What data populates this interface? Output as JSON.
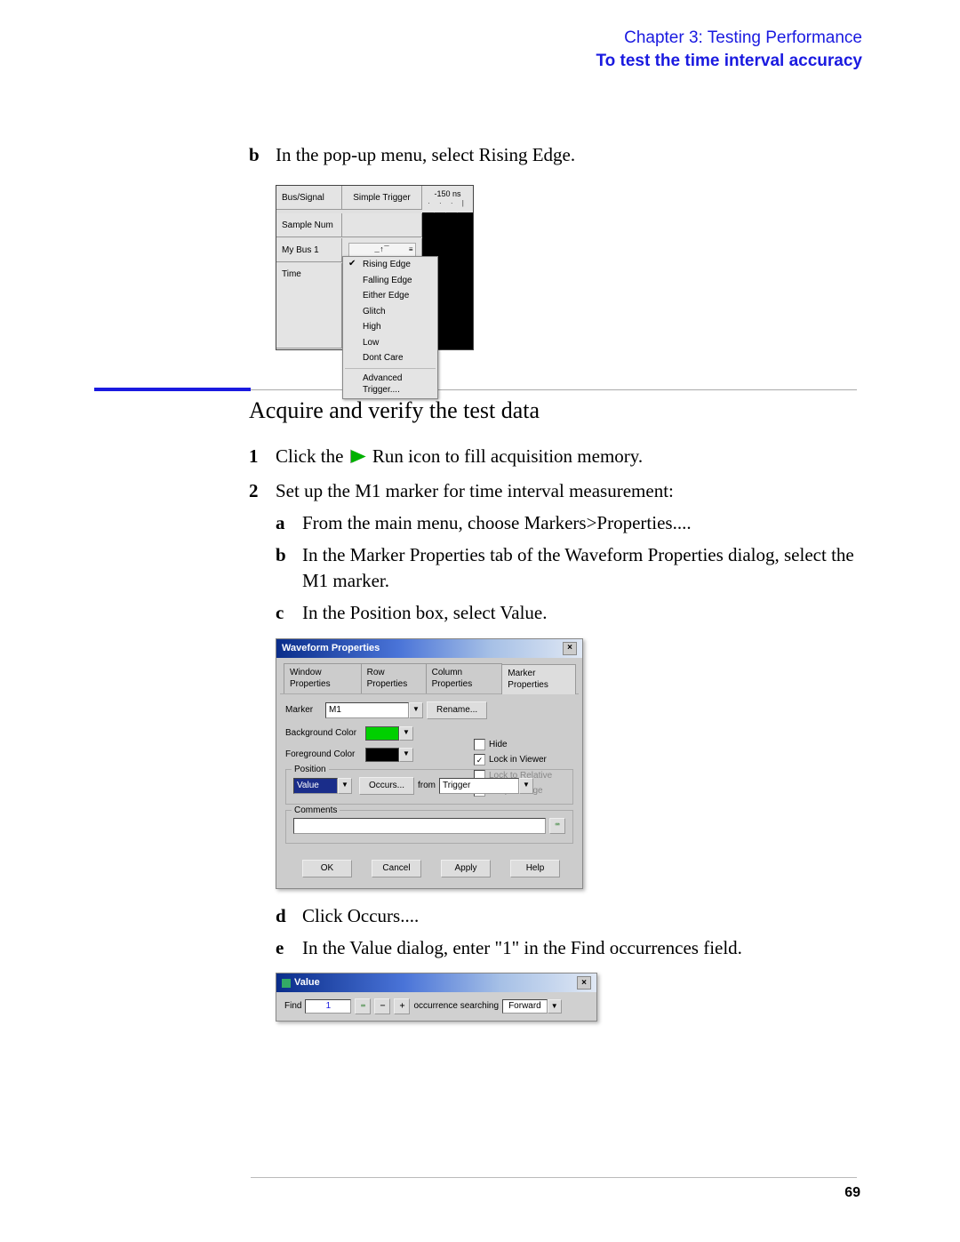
{
  "header": {
    "chapter": "Chapter 3: Testing Performance",
    "subtitle": "To test the time interval accuracy"
  },
  "step_b": "In the pop-up menu, select Rising Edge.",
  "shot1": {
    "col_bus": "Bus/Signal",
    "col_trigger": "Simple Trigger",
    "time_head": "-150 ns",
    "row_sample": "Sample Num",
    "row_mybus": "My Bus 1",
    "row_time": "Time",
    "menu": {
      "items": [
        "Rising Edge",
        "Falling Edge",
        "Either Edge",
        "Glitch",
        "High",
        "Low",
        "Dont Care"
      ],
      "advanced": "Advanced Trigger...."
    }
  },
  "section_heading": "Acquire and verify the test data",
  "step1_pre": "Click the",
  "step1_post": " Run icon to fill acquisition memory.",
  "step2": "Set up the M1 marker for time interval measurement:",
  "step2a": "From the main menu, choose Markers>Properties....",
  "step2b": "In the Marker Properties tab of the Waveform Properties dialog, select the M1 marker.",
  "step2c": "In the Position box, select Value.",
  "shot2": {
    "title": "Waveform Properties",
    "tabs": [
      "Window Properties",
      "Row Properties",
      "Column Properties",
      "Marker Properties"
    ],
    "marker_label": "Marker",
    "marker_value": "M1",
    "rename": "Rename...",
    "bg_label": "Background Color",
    "fg_label": "Foreground Color",
    "chk_hide": "Hide",
    "chk_lockviewer": "Lock in Viewer",
    "chk_lockrel": "Lock to Relative",
    "chk_snap": "Snap to Edge",
    "group_position": "Position",
    "pos_value": "Value",
    "occurs": "Occurs...",
    "from": "from",
    "trigger": "Trigger",
    "group_comments": "Comments",
    "btn_ok": "OK",
    "btn_cancel": "Cancel",
    "btn_apply": "Apply",
    "btn_help": "Help"
  },
  "step2d": "Click Occurs....",
  "step2e": "In the Value dialog, enter \"1\" in the Find occurrences field.",
  "shot3": {
    "title": "Value",
    "find": "Find",
    "value": "1",
    "occ": "occurrence searching",
    "forward": "Forward"
  },
  "page_number": "69"
}
